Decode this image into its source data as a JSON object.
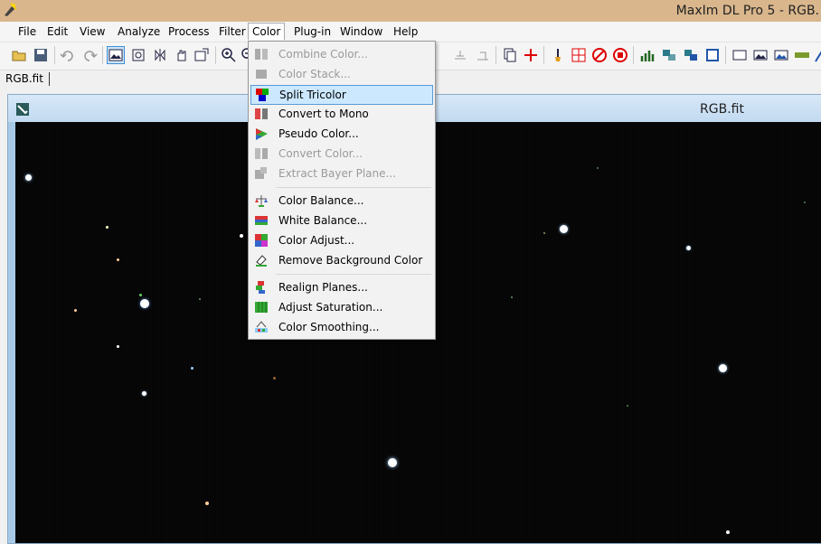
{
  "window": {
    "title": "MaxIm DL Pro 5 - RGB."
  },
  "menubar": {
    "items": [
      {
        "label": "File"
      },
      {
        "label": "Edit"
      },
      {
        "label": "View"
      },
      {
        "label": "Analyze"
      },
      {
        "label": "Process"
      },
      {
        "label": "Filter"
      },
      {
        "label": "Color"
      },
      {
        "label": "Plug-in"
      },
      {
        "label": "Window"
      },
      {
        "label": "Help"
      }
    ],
    "active": "Color"
  },
  "doc_tab": {
    "label": "RGB.fit"
  },
  "image_window": {
    "title": "RGB.fit"
  },
  "color_menu": {
    "items": [
      {
        "label": "Combine Color...",
        "enabled": false,
        "icon": "combine-color-icon"
      },
      {
        "label": "Color Stack...",
        "enabled": false,
        "icon": "color-stack-icon"
      },
      {
        "label": "Split Tricolor",
        "enabled": true,
        "highlighted": true,
        "icon": "split-tricolor-icon"
      },
      {
        "label": "Convert to Mono",
        "enabled": true,
        "icon": "convert-mono-icon"
      },
      {
        "label": "Pseudo Color...",
        "enabled": true,
        "icon": "pseudo-color-icon"
      },
      {
        "label": "Convert Color...",
        "enabled": false,
        "icon": "convert-color-icon"
      },
      {
        "label": "Extract Bayer Plane...",
        "enabled": false,
        "icon": "extract-bayer-icon"
      },
      {
        "label": "Color Balance...",
        "enabled": true,
        "icon": "color-balance-icon"
      },
      {
        "label": "White Balance...",
        "enabled": true,
        "icon": "white-balance-icon"
      },
      {
        "label": "Color Adjust...",
        "enabled": true,
        "icon": "color-adjust-icon"
      },
      {
        "label": "Remove Background Color",
        "enabled": true,
        "icon": "remove-background-icon"
      },
      {
        "label": "Realign Planes...",
        "enabled": true,
        "icon": "realign-planes-icon"
      },
      {
        "label": "Adjust Saturation...",
        "enabled": true,
        "icon": "adjust-saturation-icon"
      },
      {
        "label": "Color Smoothing...",
        "enabled": true,
        "icon": "color-smoothing-icon"
      }
    ]
  },
  "colors": {
    "titlebar": "#d9b68c",
    "menu_highlight": "#cce8ff",
    "image_background": "#050505"
  }
}
